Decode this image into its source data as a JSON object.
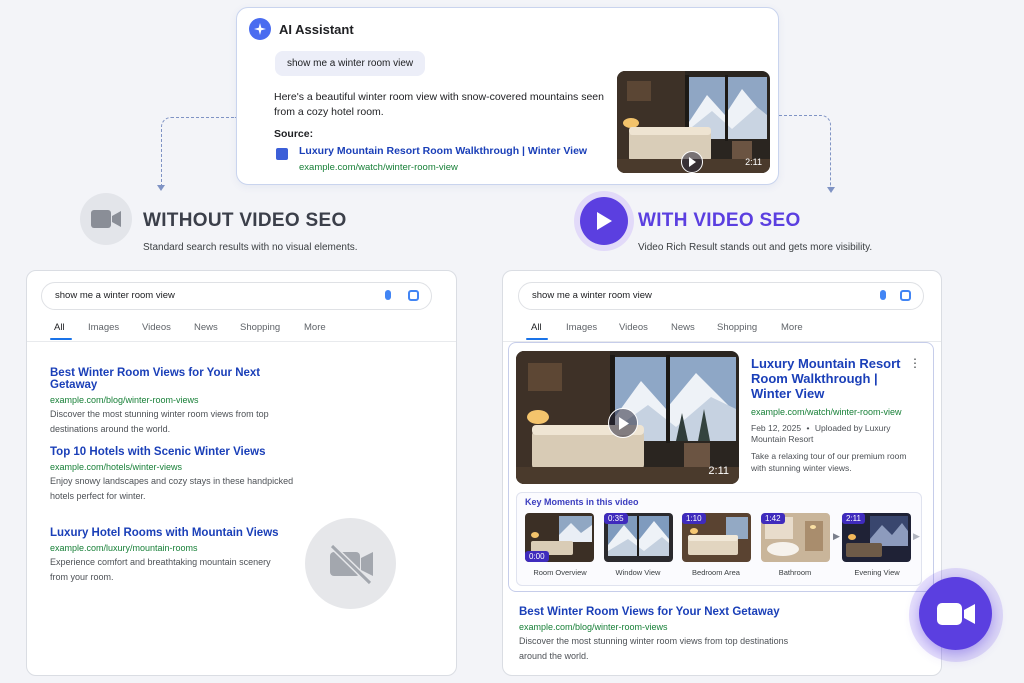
{
  "ai_card": {
    "title": "AI Assistant",
    "query": "show me a winter room view",
    "answer": "Here's a beautiful winter room view with snow-covered mountains seen from a cozy hotel room.",
    "source_label": "Source:",
    "source_link": "Luxury Mountain Resort Room Walkthrough | Winter View",
    "source_url": "example.com/watch/winter-room-view",
    "thumb_duration": "2:11",
    "logo_icon": "sparkle-icon"
  },
  "without": {
    "title": "WITHOUT VIDEO SEO",
    "subtitle": "Standard search results with no visual elements.",
    "icon": "video-camera-icon"
  },
  "with": {
    "title": "WITH VIDEO SEO",
    "subtitle": "Video Rich Result stands out and gets more visibility.",
    "icon": "play-icon"
  },
  "search": {
    "query": "show me a winter room view",
    "tabs": [
      "All",
      "Images",
      "Videos",
      "News",
      "Shopping",
      "More"
    ]
  },
  "left_results": [
    {
      "title": "Best Winter Room Views for Your Next Getaway",
      "url": "example.com/blog/winter-room-views",
      "desc": "Discover the most stunning winter room views from top destinations around the world."
    },
    {
      "title": "Top 10 Hotels with Scenic Winter Views",
      "url": "example.com/hotels/winter-views",
      "desc": "Enjoy snowy landscapes and cozy stays in these handpicked hotels perfect for winter."
    },
    {
      "title": "Luxury Hotel Rooms with Mountain Views",
      "url": "example.com/luxury/mountain-rooms",
      "desc": "Experience comfort and breathtaking mountain scenery from your room."
    }
  ],
  "rich_result": {
    "title": "Luxury Mountain Resort Room Walkthrough | Winter View",
    "url": "example.com/watch/winter-room-view",
    "date": "Feb 12, 2025",
    "uploader": "Uploaded by Luxury Mountain Resort",
    "desc": "Take a relaxing tour of our premium room with stunning winter views.",
    "duration": "2:11",
    "key_moments_title": "Key Moments in this video",
    "key_moments": [
      {
        "time": "0:00",
        "label": "Room Overview"
      },
      {
        "time": "0:35",
        "label": "Window View"
      },
      {
        "time": "1:10",
        "label": "Bedroom Area"
      },
      {
        "time": "1:42",
        "label": "Bathroom"
      },
      {
        "time": "2:11",
        "label": "Evening View"
      }
    ]
  },
  "right_results": [
    {
      "title": "Best Winter Room Views for Your Next Getaway",
      "url": "example.com/blog/winter-room-views",
      "desc": "Discover the most stunning winter room views from top destinations around the world."
    }
  ],
  "colors": {
    "accent_purple": "#5b3fe0",
    "link_blue": "#1a3fb8",
    "url_green": "#188038"
  }
}
